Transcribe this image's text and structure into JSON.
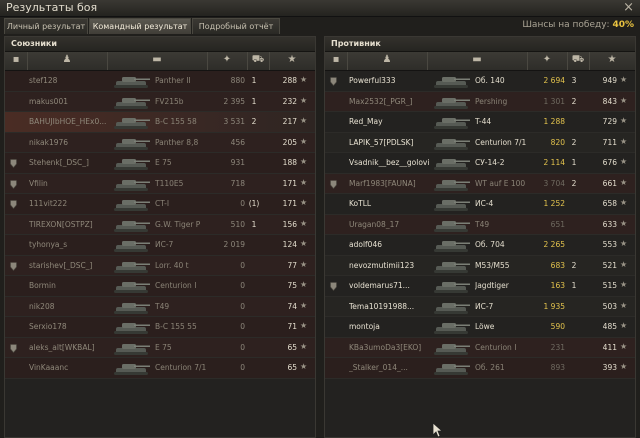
{
  "window": {
    "title": "Результаты боя"
  },
  "tabs": [
    {
      "label": "Личный результат",
      "active": false
    },
    {
      "label": "Командный результат",
      "active": true
    },
    {
      "label": "Подробный отчёт",
      "active": false
    }
  ],
  "win_chance": {
    "label": "Шансы на победу:",
    "value": "40%"
  },
  "allies": {
    "title": "Союзники",
    "rows": [
      {
        "name": "stef128",
        "vehicle": "Panther II",
        "damage": "880",
        "kills": "1",
        "xp": "288",
        "dead": true,
        "icon": ""
      },
      {
        "name": "makus001",
        "vehicle": "FV215b",
        "damage": "2 395",
        "kills": "1",
        "xp": "232",
        "dead": true,
        "icon": ""
      },
      {
        "name": "BAHUJIbHOE_HEx0...",
        "vehicle": "B-C 155 58",
        "damage": "3 531",
        "kills": "2",
        "xp": "217",
        "dead": true,
        "icon": "",
        "highlight": true
      },
      {
        "name": "nikak1976",
        "vehicle": "Panther 8,8",
        "damage": "456",
        "kills": "",
        "xp": "205",
        "dead": true,
        "icon": ""
      },
      {
        "name": "Stehenk[_DSC_]",
        "vehicle": "E 75",
        "damage": "931",
        "kills": "",
        "xp": "188",
        "dead": true,
        "icon": "platoon"
      },
      {
        "name": "Vfilin",
        "vehicle": "T110E5",
        "damage": "718",
        "kills": "",
        "xp": "171",
        "dead": true,
        "icon": "platoon"
      },
      {
        "name": "111vit222",
        "vehicle": "CT-I",
        "damage": "0",
        "kills": "(1)",
        "xp": "171",
        "dead": true,
        "icon": "platoon"
      },
      {
        "name": "TIREXON[OSTPZ]",
        "vehicle": "G.W. Tiger P",
        "damage": "510",
        "kills": "1",
        "xp": "156",
        "dead": true,
        "icon": ""
      },
      {
        "name": "tyhonya_s",
        "vehicle": "ИС-7",
        "damage": "2 019",
        "kills": "",
        "xp": "124",
        "dead": true,
        "icon": ""
      },
      {
        "name": "starishev[_DSC_]",
        "vehicle": "Lorr. 40 t",
        "damage": "0",
        "kills": "",
        "xp": "77",
        "dead": true,
        "icon": "platoon"
      },
      {
        "name": "Bormin",
        "vehicle": "Centurion I",
        "damage": "0",
        "kills": "",
        "xp": "75",
        "dead": true,
        "icon": ""
      },
      {
        "name": "nik208",
        "vehicle": "T49",
        "damage": "0",
        "kills": "",
        "xp": "74",
        "dead": true,
        "icon": ""
      },
      {
        "name": "Serxio178",
        "vehicle": "B-C 155 55",
        "damage": "0",
        "kills": "",
        "xp": "71",
        "dead": true,
        "icon": ""
      },
      {
        "name": "aleks_alt[WKBAL]",
        "vehicle": "E 75",
        "damage": "0",
        "kills": "",
        "xp": "65",
        "dead": true,
        "icon": "platoon"
      },
      {
        "name": "VinKaaanc",
        "vehicle": "Centurion 7/1",
        "damage": "0",
        "kills": "",
        "xp": "65",
        "dead": true,
        "icon": ""
      }
    ]
  },
  "enemies": {
    "title": "Противник",
    "rows": [
      {
        "name": "Powerful333",
        "vehicle": "Об. 140",
        "damage": "2 694",
        "kills": "3",
        "xp": "949",
        "dead": false,
        "icon": "platoon",
        "yellow": true
      },
      {
        "name": "Max2532[_PGR_]",
        "vehicle": "Pershing",
        "damage": "1 301",
        "kills": "2",
        "xp": "843",
        "dead": true,
        "icon": ""
      },
      {
        "name": "Red_May",
        "vehicle": "T-44",
        "damage": "1 288",
        "kills": "",
        "xp": "729",
        "dead": false,
        "icon": "",
        "yellow": true
      },
      {
        "name": "LAPIK_57[PDLSK]",
        "vehicle": "Centurion 7/1",
        "damage": "820",
        "kills": "2",
        "xp": "711",
        "dead": false,
        "icon": "",
        "yellow": true
      },
      {
        "name": "Vsadnik__bez__golovi",
        "vehicle": "СУ-14-2",
        "damage": "2 114",
        "kills": "1",
        "xp": "676",
        "dead": false,
        "icon": "",
        "yellow": true
      },
      {
        "name": "Marf1983[FAUNA]",
        "vehicle": "WT auf E 100",
        "damage": "3 704",
        "kills": "2",
        "xp": "661",
        "dead": true,
        "icon": "platoon"
      },
      {
        "name": "KoTLL",
        "vehicle": "ИС-4",
        "damage": "1 252",
        "kills": "",
        "xp": "658",
        "dead": false,
        "icon": "",
        "yellow": true
      },
      {
        "name": "Uragan08_17",
        "vehicle": "T49",
        "damage": "651",
        "kills": "",
        "xp": "633",
        "dead": true,
        "icon": ""
      },
      {
        "name": "adolf046",
        "vehicle": "Об. 704",
        "damage": "2 265",
        "kills": "",
        "xp": "553",
        "dead": false,
        "icon": "",
        "yellow": true
      },
      {
        "name": "nevozmutimii123",
        "vehicle": "M53/M55",
        "damage": "683",
        "kills": "2",
        "xp": "521",
        "dead": false,
        "icon": "",
        "yellow": true
      },
      {
        "name": "voldemarus71...",
        "vehicle": "Jagdtiger",
        "damage": "163",
        "kills": "1",
        "xp": "515",
        "dead": false,
        "icon": "platoon",
        "yellow": true
      },
      {
        "name": "Tema10191988...",
        "vehicle": "ИС-7",
        "damage": "1 935",
        "kills": "",
        "xp": "503",
        "dead": false,
        "icon": "",
        "yellow": true
      },
      {
        "name": "montoja",
        "vehicle": "Löwe",
        "damage": "590",
        "kills": "",
        "xp": "485",
        "dead": false,
        "icon": "",
        "yellow": true
      },
      {
        "name": "KBa3umoDa3[EKO]",
        "vehicle": "Centurion I",
        "damage": "231",
        "kills": "",
        "xp": "411",
        "dead": true,
        "icon": ""
      },
      {
        "name": "_Stalker_014_...",
        "vehicle": "Об. 261",
        "damage": "893",
        "kills": "",
        "xp": "393",
        "dead": true,
        "icon": ""
      }
    ]
  },
  "columns": [
    {
      "icon": "squad-icon"
    },
    {
      "icon": "player-icon"
    },
    {
      "icon": "vehicle-icon"
    },
    {
      "icon": "damage-icon"
    },
    {
      "icon": "kills-icon"
    },
    {
      "icon": "star-icon"
    }
  ],
  "colors": {
    "yellow_damage": "#e3c34d",
    "accent_chance": "#e8c240",
    "dead_row": "#2b1f1d"
  }
}
